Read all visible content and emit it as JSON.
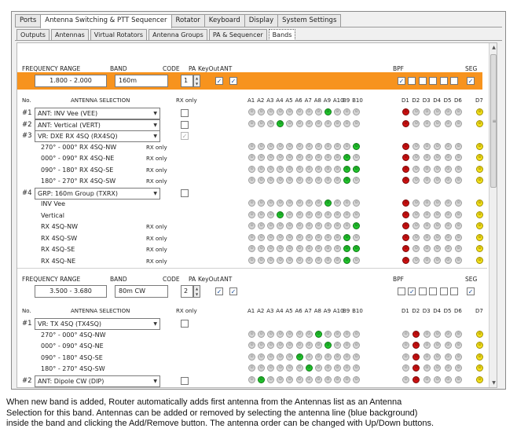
{
  "main_tabs": [
    {
      "label": "Ports",
      "active": false
    },
    {
      "label": "Antenna Switching & PTT Sequencer",
      "active": true
    },
    {
      "label": "Rotator",
      "active": false
    },
    {
      "label": "Keyboard",
      "active": false
    },
    {
      "label": "Display",
      "active": false
    },
    {
      "label": "System Settings",
      "active": false
    }
  ],
  "sub_tabs": [
    {
      "label": "Outputs",
      "active": false
    },
    {
      "label": "Antennas",
      "active": false
    },
    {
      "label": "Virtual Rotators",
      "active": false
    },
    {
      "label": "Antenna Groups",
      "active": false
    },
    {
      "label": "PA & Sequencer",
      "active": false
    },
    {
      "label": "Bands",
      "active": true
    }
  ],
  "headers": {
    "frequency_range": "FREQUENCY RANGE",
    "band": "BAND",
    "code": "CODE",
    "pa": "PA",
    "keyout": "KeyOut",
    "ant": "ANT",
    "bpf": "BPF",
    "seg": "SEG",
    "no": "No.",
    "antenna_selection": "ANTENNA SELECTION",
    "rx_only": "RX only"
  },
  "led_columns": {
    "antennas": [
      "A1",
      "A2",
      "A3",
      "A4",
      "A5",
      "A6",
      "A7",
      "A8",
      "A9",
      "A10",
      "B9",
      "B10"
    ],
    "bpf": [
      "D1",
      "D2",
      "D3",
      "D4",
      "D5",
      "D6"
    ],
    "seg": [
      "D7"
    ]
  },
  "colors": {
    "selected_band_highlight": "#f7931e",
    "led_active_ant": "#22c22e",
    "led_active_bpf": "#cc1212",
    "led_active_seg": "#f2e01a",
    "led_off": "#d6d6d6"
  },
  "band1": {
    "frequency_range": "1.800 - 2.000",
    "band": "160m",
    "code": "1",
    "pa_checked": true,
    "keyout_checked": true,
    "bpf_checks": [
      true,
      false,
      false,
      false,
      false,
      false
    ],
    "seg_checked": true,
    "rows": [
      {
        "kind": "selection",
        "num": "#1",
        "label": "ANT:  INV Vee  (VEE)",
        "rx_checkbox": "unchecked",
        "ant_on": [
          8
        ],
        "bpf_on": 0
      },
      {
        "kind": "selection",
        "num": "#2",
        "label": "ANT:  Vertical  (VERT)",
        "rx_checkbox": "unchecked",
        "ant_on": [
          3
        ],
        "bpf_on": 0
      },
      {
        "kind": "selection",
        "num": "#3",
        "label": "VR:  DXE RX 4SQ  (RX4SQ)",
        "rx_checkbox": "disabled-checked",
        "ant_on": [],
        "bpf_on": -1
      },
      {
        "kind": "sub",
        "label": "270° - 000° RX 4SQ-NW",
        "rx_text": "RX only",
        "ant_on": [
          11
        ],
        "bpf_on": 0
      },
      {
        "kind": "sub",
        "label": "000° - 090° RX 4SQ-NE",
        "rx_text": "RX only",
        "ant_on": [
          10
        ],
        "bpf_on": 0
      },
      {
        "kind": "sub",
        "label": "090° - 180° RX 4SQ-SE",
        "rx_text": "RX only",
        "ant_on": [
          10,
          11
        ],
        "bpf_on": 0
      },
      {
        "kind": "sub",
        "label": "180° - 270° RX 4SQ-SW",
        "rx_text": "RX only",
        "ant_on": [
          10
        ],
        "bpf_on": 0
      },
      {
        "kind": "selection",
        "num": "#4",
        "label": "GRP:  160m Group  (TXRX)",
        "rx_checkbox": "unchecked",
        "ant_on": [],
        "bpf_on": -1
      },
      {
        "kind": "sub",
        "label": "INV Vee",
        "rx_text": "",
        "ant_on": [
          8
        ],
        "bpf_on": 0
      },
      {
        "kind": "sub",
        "label": "Vertical",
        "rx_text": "",
        "ant_on": [
          3
        ],
        "bpf_on": 0
      },
      {
        "kind": "sub",
        "label": "RX 4SQ-NW",
        "rx_text": "RX only",
        "ant_on": [
          11
        ],
        "bpf_on": 0
      },
      {
        "kind": "sub",
        "label": "RX 4SQ-SW",
        "rx_text": "RX only",
        "ant_on": [
          10
        ],
        "bpf_on": 0
      },
      {
        "kind": "sub",
        "label": "RX 4SQ-SE",
        "rx_text": "RX only",
        "ant_on": [
          10,
          11
        ],
        "bpf_on": 0
      },
      {
        "kind": "sub",
        "label": "RX 4SQ-NE",
        "rx_text": "RX only",
        "ant_on": [
          10
        ],
        "bpf_on": 0
      }
    ]
  },
  "band2": {
    "frequency_range": "3.500 - 3.680",
    "band": "80m CW",
    "code": "2",
    "pa_checked": true,
    "keyout_checked": true,
    "bpf_checks": [
      false,
      true,
      false,
      false,
      false,
      false
    ],
    "seg_checked": true,
    "rows": [
      {
        "kind": "selection",
        "num": "#1",
        "label": "VR:  TX 4SQ  (TX4SQ)",
        "rx_checkbox": "unchecked",
        "ant_on": [],
        "bpf_on": -1
      },
      {
        "kind": "sub",
        "label": "270° - 000° 4SQ-NW",
        "rx_text": "",
        "ant_on": [
          7
        ],
        "bpf_on": 1
      },
      {
        "kind": "sub",
        "label": "000° - 090° 4SQ-NE",
        "rx_text": "",
        "ant_on": [
          8
        ],
        "bpf_on": 1
      },
      {
        "kind": "sub",
        "label": "090° - 180° 4SQ-SE",
        "rx_text": "",
        "ant_on": [
          5
        ],
        "bpf_on": 1
      },
      {
        "kind": "sub",
        "label": "180° - 270° 4SQ-SW",
        "rx_text": "",
        "ant_on": [
          6
        ],
        "bpf_on": 1
      },
      {
        "kind": "selection",
        "num": "#2",
        "label": "ANT:  Dipole CW  (DIP)",
        "rx_checkbox": "unchecked",
        "ant_on": [
          1
        ],
        "bpf_on": 1
      }
    ]
  },
  "caption": [
    "When new band is added, Router automatically adds first antenna from the Antennas list as an Antenna",
    "Selection for this band.  Antennas can be added or removed by selecting the antenna line (blue background)",
    "inside the band and clicking the Add/Remove button.  The antenna order can be changed with Up/Down buttons."
  ]
}
